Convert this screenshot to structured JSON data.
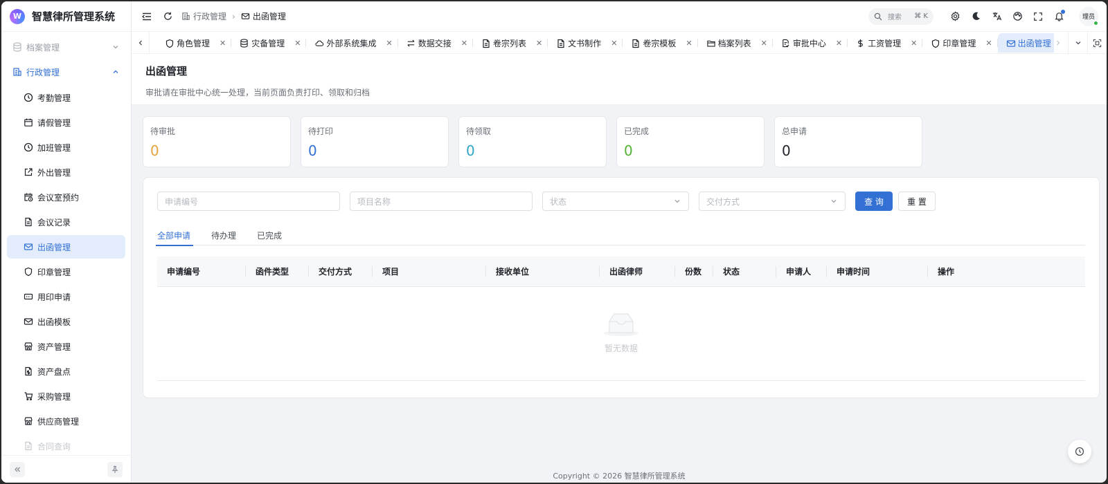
{
  "app": {
    "title": "智慧律所管理系统",
    "logo_text": "W"
  },
  "sidebar": {
    "groups": [
      {
        "label": "档案管理",
        "icon": "database-icon",
        "state": "collapsed"
      },
      {
        "label": "行政管理",
        "icon": "building-icon",
        "state": "expanded"
      }
    ],
    "items": [
      {
        "label": "考勤管理",
        "icon": "clock-icon"
      },
      {
        "label": "请假管理",
        "icon": "calendar-icon"
      },
      {
        "label": "加班管理",
        "icon": "clock-icon"
      },
      {
        "label": "外出管理",
        "icon": "external-link-icon"
      },
      {
        "label": "会议室预约",
        "icon": "calendar-clock-icon"
      },
      {
        "label": "会议记录",
        "icon": "document-icon"
      },
      {
        "label": "出函管理",
        "icon": "mail-icon",
        "selected": true
      },
      {
        "label": "印章管理",
        "icon": "shield-icon"
      },
      {
        "label": "用印申请",
        "icon": "card-icon"
      },
      {
        "label": "出函模板",
        "icon": "mail-icon"
      },
      {
        "label": "资产管理",
        "icon": "store-icon"
      },
      {
        "label": "资产盘点",
        "icon": "document-dollar-icon"
      },
      {
        "label": "采购管理",
        "icon": "cart-icon"
      },
      {
        "label": "供应商管理",
        "icon": "store-icon"
      },
      {
        "label": "合同查询",
        "icon": "document-icon"
      }
    ]
  },
  "header": {
    "breadcrumb": [
      {
        "label": "行政管理",
        "icon": "building-icon"
      },
      {
        "label": "出函管理",
        "icon": "mail-icon"
      }
    ],
    "search": {
      "placeholder": "搜索",
      "shortcut": "⌘ K"
    },
    "user": {
      "name": "理员"
    }
  },
  "tabs": [
    {
      "label": "角色管理",
      "icon": "shield-icon"
    },
    {
      "label": "灾备管理",
      "icon": "database-icon"
    },
    {
      "label": "外部系统集成",
      "icon": "cloud-icon"
    },
    {
      "label": "数据交接",
      "icon": "swap-icon"
    },
    {
      "label": "卷宗列表",
      "icon": "document-icon"
    },
    {
      "label": "文书制作",
      "icon": "document-icon"
    },
    {
      "label": "卷宗模板",
      "icon": "document-icon"
    },
    {
      "label": "档案列表",
      "icon": "folder-icon"
    },
    {
      "label": "审批中心",
      "icon": "approval-icon"
    },
    {
      "label": "工资管理",
      "icon": "dollar-icon"
    },
    {
      "label": "印章管理",
      "icon": "shield-icon"
    },
    {
      "label": "出函管理",
      "icon": "mail-icon",
      "active": true
    }
  ],
  "page": {
    "title": "出函管理",
    "description": "审批请在审批中心统一处理，当前页面负责打印、领取和归档"
  },
  "stats": [
    {
      "label": "待审批",
      "value": "0",
      "color": "#e8a33c"
    },
    {
      "label": "待打印",
      "value": "0",
      "color": "#3370d4"
    },
    {
      "label": "待领取",
      "value": "0",
      "color": "#2fa7c4"
    },
    {
      "label": "已完成",
      "value": "0",
      "color": "#52b335"
    },
    {
      "label": "总申请",
      "value": "0",
      "color": "#1f2329"
    }
  ],
  "filters": {
    "app_no": {
      "placeholder": "申请编号"
    },
    "project": {
      "placeholder": "项目名称"
    },
    "status": {
      "placeholder": "状态"
    },
    "delivery": {
      "placeholder": "交付方式"
    },
    "search_label": "查 询",
    "reset_label": "重 置"
  },
  "subtabs": [
    {
      "label": "全部申请",
      "active": true
    },
    {
      "label": "待办理"
    },
    {
      "label": "已完成"
    }
  ],
  "table": {
    "columns": [
      "申请编号",
      "函件类型",
      "交付方式",
      "项目",
      "接收单位",
      "出函律师",
      "份数",
      "状态",
      "申请人",
      "申请时间",
      "操作"
    ],
    "rows": [],
    "empty_text": "暂无数据"
  },
  "footer": {
    "copyright": "Copyright © 2026  智慧律所管理系统"
  },
  "colors": {
    "accent": "#3370d4",
    "selected_bg": "#e3ecfb"
  }
}
